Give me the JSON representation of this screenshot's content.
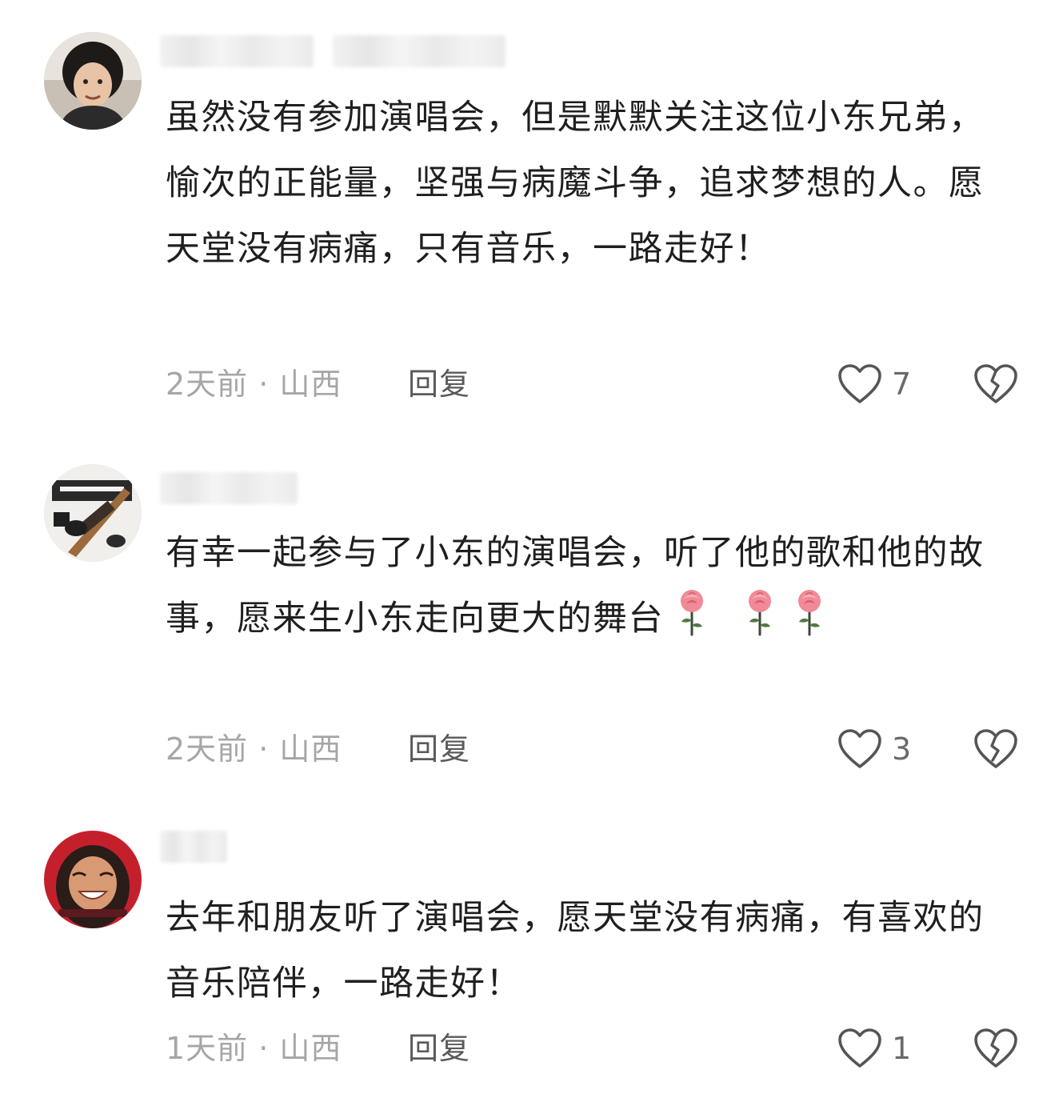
{
  "comments": [
    {
      "text": "虽然没有参加演唱会，但是默默关注这位小东兄弟，愉次的正能量，坚强与病魔斗争，追求梦想的人。愿天堂没有病痛，只有音乐，一路走好！",
      "time_location": "2天前 · 山西",
      "reply_label": "回复",
      "likes": "7"
    },
    {
      "text_main": "有幸一起参与了小东的演唱会，听了他的歌和他的故事，愿来生小东走向更大的舞台",
      "emoji": [
        "rose",
        "rose",
        "rose"
      ],
      "time_location": "2天前 · 山西",
      "reply_label": "回复",
      "likes": "3"
    },
    {
      "text": "去年和朋友听了演唱会，愿天堂没有病痛，有喜欢的音乐陪伴，一路走好！",
      "time_location": "1天前 · 山西",
      "reply_label": "回复",
      "likes": "1"
    }
  ],
  "icons": {
    "like": "heart-outline-icon",
    "dislike": "broken-heart-outline-icon",
    "emoji": "rose-emoji"
  },
  "colors": {
    "text": "#1f1f1f",
    "meta": "#a6a6a6",
    "reply": "#5a5a5a",
    "icon": "#555555",
    "rose": "#f08a96"
  }
}
